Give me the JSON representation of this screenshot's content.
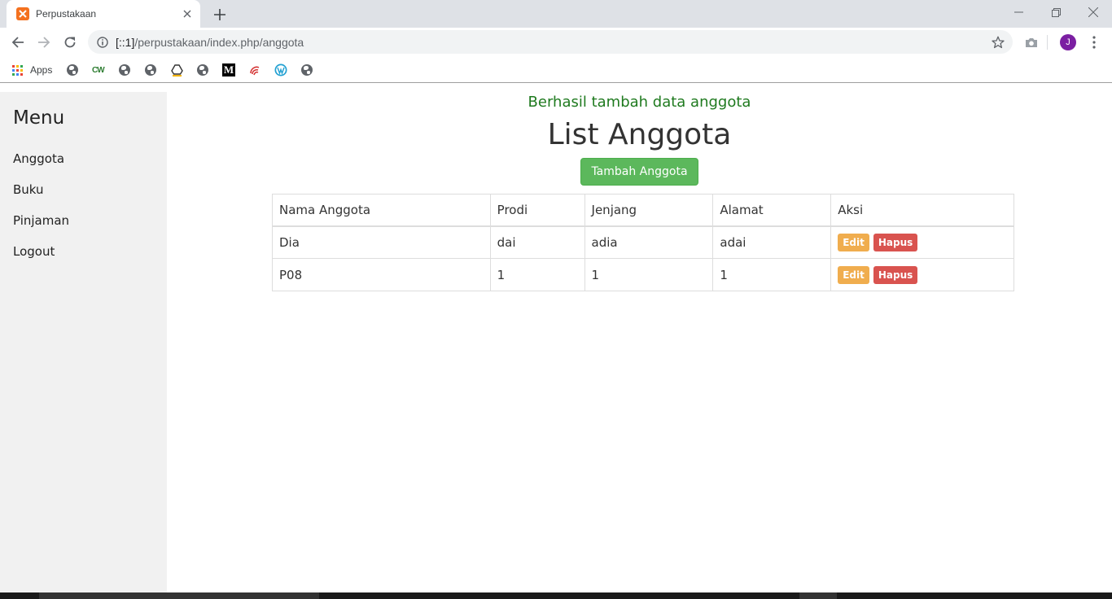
{
  "browser": {
    "tab_title": "Perpustakaan",
    "url_host": "[::1]",
    "url_path": "/perpustakaan/index.php/anggota",
    "profile_initial": "J",
    "bookmarks": {
      "apps_label": "Apps"
    }
  },
  "sidebar": {
    "title": "Menu",
    "items": [
      {
        "label": "Anggota"
      },
      {
        "label": "Buku"
      },
      {
        "label": "Pinjaman"
      },
      {
        "label": "Logout"
      }
    ]
  },
  "main": {
    "flash_message": "Berhasil tambah data anggota",
    "title": "List Anggota",
    "add_button": "Tambah Anggota",
    "table": {
      "headers": [
        "Nama Anggota",
        "Prodi",
        "Jenjang",
        "Alamat",
        "Aksi"
      ],
      "rows": [
        {
          "nama": "Dia",
          "prodi": "dai",
          "jenjang": "adia",
          "alamat": "adai",
          "edit": "Edit",
          "hapus": "Hapus"
        },
        {
          "nama": "P08",
          "prodi": "1",
          "jenjang": "1",
          "alamat": "1",
          "edit": "Edit",
          "hapus": "Hapus"
        }
      ]
    }
  },
  "colors": {
    "success_button": "#5cb85c",
    "flash_text": "#1f7a1f",
    "edit_label": "#f0ad4e",
    "delete_label": "#d9534f",
    "sidebar_bg": "#f1f1f1",
    "profile": "#7b1fa2",
    "favicon": "#f4711f"
  }
}
